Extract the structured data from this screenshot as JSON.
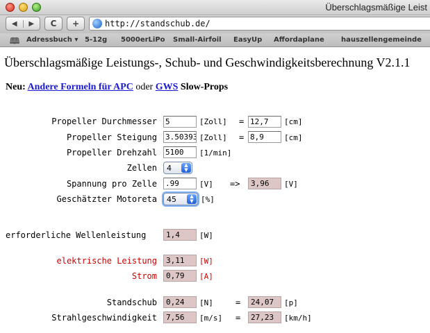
{
  "window": {
    "title": "Überschlagsmäßige Leist"
  },
  "toolbar": {
    "url": "http://standschub.de/",
    "back_glyph": "◀",
    "forward_glyph": "▶",
    "reload_glyph": "C",
    "add_glyph": "+"
  },
  "bookmarks": [
    "Adressbuch ▾",
    "5-12g",
    "5000erLiPo",
    "Small-Airfoil",
    "EasyUp",
    "Affordaplane",
    "hauszellengemeinde"
  ],
  "page": {
    "title": "Überschlagsmäßige Leistungs-, Schub- und Geschwindigkeitsberechnung V2.1.1",
    "neu_label": "Neu:",
    "link_apc": "Andere Formeln für APC",
    "oder": "oder",
    "link_gws": "GWS",
    "slow_props": "Slow-Props"
  },
  "form": {
    "durchmesser": {
      "label": "Propeller Durchmesser",
      "value": "5",
      "unit": "[Zoll]",
      "eq": "=",
      "result": "12,7",
      "result_unit": "[cm]"
    },
    "steigung": {
      "label": "Propeller Steigung",
      "value": "3.50393",
      "unit": "[Zoll]",
      "eq": "=",
      "result": "8,9",
      "result_unit": "[cm]"
    },
    "drehzahl": {
      "label": "Propeller Drehzahl",
      "value": "5100",
      "unit": "[1/min]"
    },
    "zellen": {
      "label": "Zellen",
      "value": "4"
    },
    "spannung": {
      "label": "Spannung pro Zelle",
      "value": ".99",
      "unit": "[V]",
      "arrow": "=>",
      "result": "3,96",
      "result_unit": "[V]"
    },
    "motoreta": {
      "label": "Geschätzter Motoreta",
      "value": "45",
      "unit": "[%]"
    },
    "wellenleistung": {
      "label": "erforderliche Wellenleistung",
      "value": "1,4",
      "unit": "[W]"
    },
    "el_leistung": {
      "label": "elektrische Leistung",
      "value": "3,11",
      "unit": "[W]"
    },
    "strom": {
      "label": "Strom",
      "value": "0,79",
      "unit": "[A]"
    },
    "standschub": {
      "label": "Standschub",
      "value": "0,24",
      "unit": "[N]",
      "eq": "=",
      "result": "24,07",
      "result_unit": "[p]"
    },
    "strahl": {
      "label": "Strahlgeschwindigkeit",
      "value": "7,56",
      "unit": "[m/s]",
      "eq": "=",
      "result": "27,23",
      "result_unit": "[km/h]"
    }
  },
  "colors": {
    "output_bg": "#dcc6c6",
    "highlight_red": "#cc0000",
    "link_blue": "#1a1ad0"
  }
}
